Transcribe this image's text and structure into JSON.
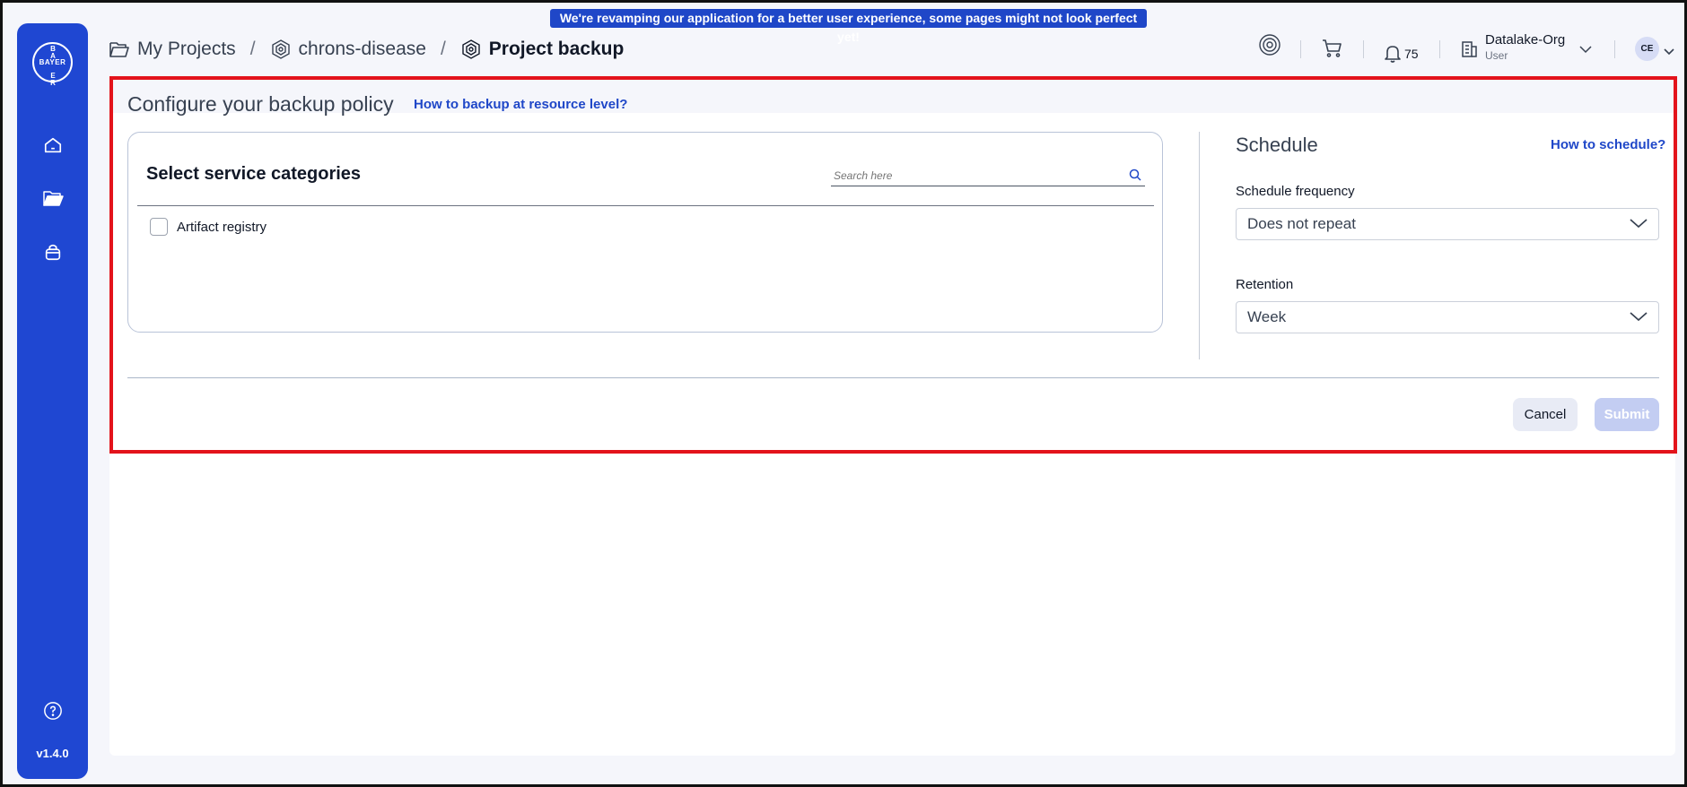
{
  "banner": "We're revamping our application for a better user experience, some pages might not look perfect yet!",
  "sidebar": {
    "logo_text": "BAYER",
    "version": "v1.4.0",
    "items": [
      {
        "icon": "home-icon"
      },
      {
        "icon": "folder-icon"
      },
      {
        "icon": "bucket-icon"
      }
    ],
    "help_icon": "help-circle-icon"
  },
  "breadcrumb": {
    "items": [
      "My Projects",
      "chrons-disease",
      "Project backup"
    ],
    "separator": "/"
  },
  "header": {
    "notifications_count": "75",
    "org_name": "Datalake-Org",
    "org_role": "User",
    "avatar_initials": "CE"
  },
  "page": {
    "title": "Configure your backup policy",
    "help_link": "How to backup at resource level?"
  },
  "services": {
    "title": "Select service categories",
    "search_placeholder": "Search here",
    "items": [
      {
        "label": "Artifact registry",
        "checked": false
      }
    ]
  },
  "schedule": {
    "title": "Schedule",
    "help_link": "How to schedule?",
    "frequency_label": "Schedule frequency",
    "frequency_value": "Does not repeat",
    "retention_label": "Retention",
    "retention_value": "Week"
  },
  "actions": {
    "cancel": "Cancel",
    "submit": "Submit"
  },
  "colors": {
    "accent": "#1f47d2",
    "highlight_border": "#e3131b",
    "submit_disabled": "#c3cdf2"
  }
}
